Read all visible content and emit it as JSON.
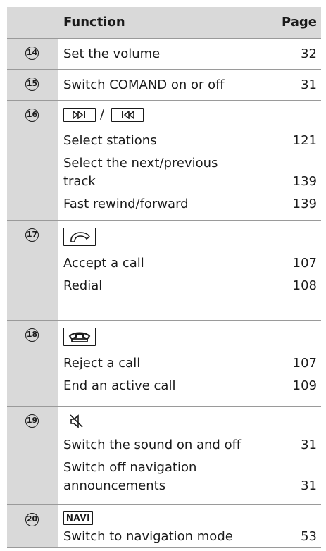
{
  "header": {
    "function_label": "Function",
    "page_label": "Page"
  },
  "rows": [
    {
      "number": "14",
      "items": [
        {
          "label": "Set the volume",
          "page": "32"
        }
      ]
    },
    {
      "number": "15",
      "items": [
        {
          "label": "Switch COMAND on or off",
          "page": "31"
        }
      ]
    },
    {
      "number": "16",
      "key_icons": [
        "next-track-icon",
        "previous-track-icon"
      ],
      "separator": "/",
      "items": [
        {
          "label": "Select stations",
          "page": "121"
        },
        {
          "label": "Select the next/previous",
          "label2": "track",
          "page": "139"
        },
        {
          "label": "Fast rewind/forward",
          "page": "139"
        }
      ]
    },
    {
      "number": "17",
      "key_icons": [
        "phone-accept-icon"
      ],
      "items": [
        {
          "label": "Accept a call",
          "page": "107"
        },
        {
          "label": "Redial",
          "page": "108"
        }
      ]
    },
    {
      "number": "18",
      "key_icons": [
        "phone-hangup-icon"
      ],
      "items": [
        {
          "label": "Reject a call",
          "page": "107"
        },
        {
          "label": "End an active call",
          "page": "109"
        }
      ]
    },
    {
      "number": "19",
      "key_icons": [
        "mute-icon"
      ],
      "items": [
        {
          "label": "Switch the sound on and off",
          "page": "31"
        },
        {
          "label": "Switch off navigation",
          "label2": "announcements",
          "page": "31"
        }
      ]
    },
    {
      "number": "20",
      "key_label": "NAVI",
      "items": [
        {
          "label": "Switch to navigation mode",
          "page": "53"
        }
      ]
    }
  ]
}
